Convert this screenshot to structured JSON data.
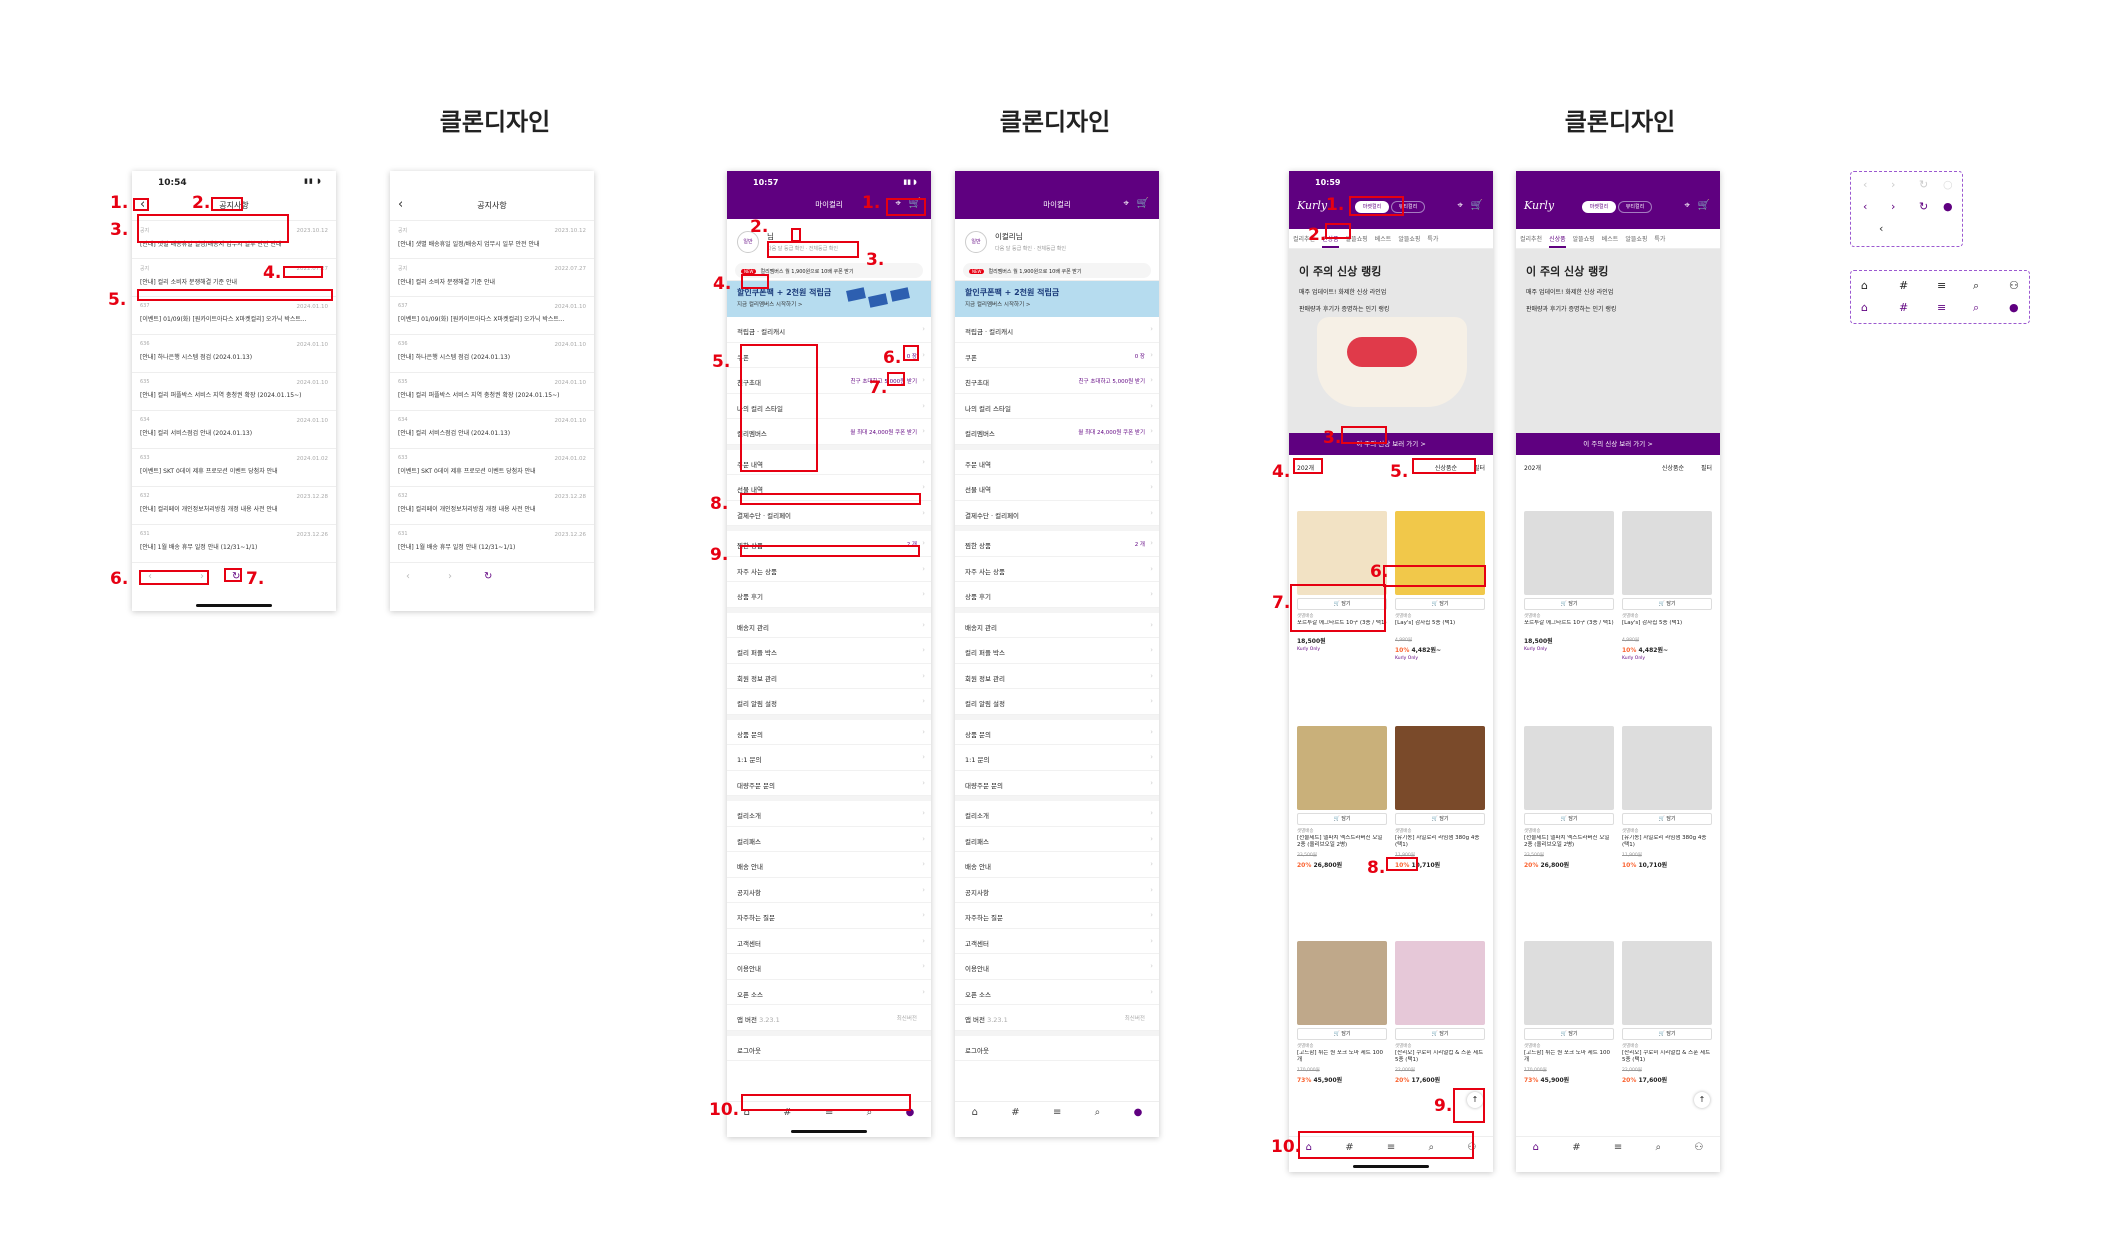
{
  "section_titles": [
    "클론디자인",
    "클론디자인",
    "클론디자인"
  ],
  "colors": {
    "brand": "#5f0080",
    "annotation": "#e60012",
    "sale": "#fa622f",
    "banner": "#b6dcef"
  },
  "notice": {
    "time": "10:54",
    "title": "공지사항",
    "back_icon": "back-icon",
    "rows": [
      {
        "num": "공지",
        "date": "2023.10.12",
        "text": "[안내] 샛별 배송휴일 일정/배송지 업무시 일부 안전 안내"
      },
      {
        "num": "공지",
        "date": "2022.07.27",
        "text": "[안내] 컬리 소비자 분쟁해결 기준 안내"
      },
      {
        "num": "637",
        "date": "2024.01.10",
        "text": "[이벤트] 01/09(화) [원카이트아다스 X마켓컬리] 오가닉 박스트..."
      },
      {
        "num": "636",
        "date": "2024.01.10",
        "text": "[안내] 하나은행 시스템 점검 (2024.01.13)"
      },
      {
        "num": "635",
        "date": "2024.01.10",
        "text": "[안내] 컬리 퍼플박스 서비스 지역 충청권 확장 (2024.01.15~)"
      },
      {
        "num": "634",
        "date": "2024.01.10",
        "text": "[안내] 컬리 서비스점검 안내 (2024.01.13)"
      },
      {
        "num": "633",
        "date": "2024.01.02",
        "text": "[이벤트] SKT 0데이 제휴 프로모션 이벤트 당첨자 안내"
      },
      {
        "num": "632",
        "date": "2023.12.28",
        "text": "[안내] 컬리페이 개인정보처리방침 개정 내용 사전 안내"
      },
      {
        "num": "631",
        "date": "2023.12.26",
        "text": "[안내] 1월 배송 휴무 일정 안내 (12/31~1/1)"
      }
    ],
    "pager": {
      "prev": "‹",
      "next": "›",
      "refresh": "↻"
    }
  },
  "mykurly": {
    "time": "10:57",
    "title": "마이컬리",
    "name": "님",
    "name_full": "이컬리님",
    "avatar": "일반",
    "grade_links": [
      "다음 달 등급 확인",
      "전체등급 확인"
    ],
    "new_badge": "NEW",
    "pill_text": "컬리멤버스 월 1,900원으로 10배 쿠폰 받기",
    "banner_title": "할인쿠폰팩 + 2천원 적립금",
    "banner_sub": "지금 컬리멤버스 시작하기 >",
    "group1": [
      {
        "label": "적립금 · 컬리캐시",
        "value": ""
      },
      {
        "label": "쿠폰",
        "value": "0 장"
      },
      {
        "label": "친구초대",
        "value": "친구 초대하고 5,000원 받기"
      },
      {
        "label": "나의 컬리 스타일",
        "value": ""
      },
      {
        "label": "컬리멤버스",
        "value": "월 최대 24,000원 쿠폰 받기"
      }
    ],
    "group2": [
      "주문 내역",
      "선물 내역",
      "결제수단 · 컬리페이"
    ],
    "group3": [
      {
        "label": "찜한 상품",
        "value": "2 개"
      },
      {
        "label": "자주 사는 상품",
        "value": ""
      },
      {
        "label": "상품 후기",
        "value": ""
      }
    ],
    "group4": [
      "배송지 관리",
      "컬리 퍼플 박스",
      "회원 정보 관리",
      "컬리 알림 설정"
    ],
    "group5": [
      "상품 문의",
      "1:1 문의",
      "대량주문 문의"
    ],
    "group6": [
      "컬리소개",
      "컬리패스",
      "배송 안내",
      "공지사항",
      "자주하는 질문",
      "고객센터",
      "이용안내",
      "오픈 소스"
    ],
    "app_version": {
      "label": "앱 버전",
      "version": "3.23.1",
      "status": "최신버전"
    },
    "logout": "로그아웃"
  },
  "kurly": {
    "time": "10:59",
    "logo": "Kurly",
    "segments": [
      "마켓컬리",
      "뷰티컬리"
    ],
    "tabs": [
      "컬리추천",
      "신상품",
      "알뜰쇼핑",
      "베스트",
      "특가/혜택",
      "알뜰쇼핑"
    ],
    "tabs_display": [
      "컬리추천",
      "신상품",
      "알뜰쇼핑",
      "베스트",
      "알뜰쇼핑",
      "특가"
    ],
    "hero_title": "이 주의 신상 랭킹",
    "hero_lines": [
      "매주 업데이트! 화제한 신상 라인업",
      "판매량과 후기가 증명하는 인기 랭킹"
    ],
    "cta": "이 주의 신상 보러 가기 >",
    "count": "202개",
    "sort": "신상품순",
    "filter": "필터",
    "cart_label": "담기",
    "products": [
      {
        "delivery": "샛별배송",
        "name": "포르투갈 에그타르트 10구 (3종 / 택1)",
        "discount": "",
        "orig": "",
        "price": "18,500원",
        "tag": "Kurly Only"
      },
      {
        "delivery": "샛별배송",
        "name": "[Lay's] 감자칩 5종 (택1)",
        "discount": "10%",
        "orig": "4,980원",
        "price": "4,482원~",
        "tag": "Kurly Only"
      },
      {
        "delivery": "샛별배송",
        "name": "[선물세트] 델파치 엑스트라버진 오일 2종 (올리브오일 2병)",
        "discount": "20%",
        "orig": "33,500원",
        "price": "26,800원",
        "tag": ""
      },
      {
        "delivery": "샛별배송",
        "name": "[유기농] 자일로리 라임잼 380g 4종 (택1)",
        "discount": "10%",
        "orig": "11,900원",
        "price": "10,710원",
        "tag": ""
      },
      {
        "delivery": "샛별배송",
        "name": "[고드함] 튀는 원 포크 도마 세트 100개",
        "discount": "73%",
        "orig": "170,000원",
        "price": "45,900원",
        "tag": ""
      },
      {
        "delivery": "샛별배송",
        "name": "[산리오] 쿠로미 시리얼컵 & 스푼 세트 5종 (택1)",
        "discount": "20%",
        "orig": "22,000원",
        "price": "17,600원",
        "tag": ""
      }
    ]
  },
  "markers": [
    "1.",
    "2.",
    "3.",
    "4.",
    "5.",
    "6.",
    "7.",
    "8.",
    "9.",
    "10."
  ],
  "legend_icons": [
    "home-icon",
    "hashtag-icon",
    "menu-icon",
    "search-icon",
    "user-icon"
  ]
}
